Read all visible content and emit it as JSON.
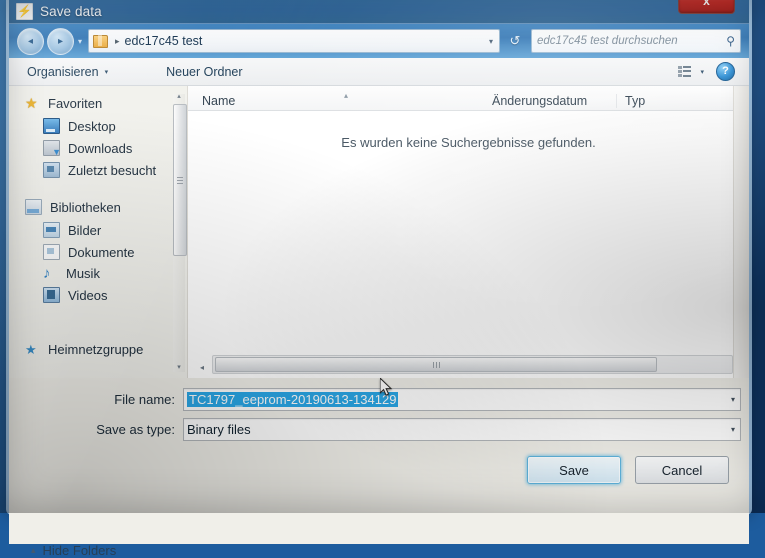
{
  "window": {
    "title": "Save data",
    "title_icon": "lightning-bolt-icon",
    "close_label": "x",
    "accent_titlebar": "#2a659e",
    "close_color": "#c0201b"
  },
  "nav": {
    "back_label": "◂",
    "forward_label": "▸",
    "history_chevron": "▾",
    "breadcrumb_folder_icon": "folder-icon",
    "breadcrumb_separator": "▸",
    "breadcrumb": "edc17c45 test",
    "address_dropdown": "▾",
    "refresh_label": "↺",
    "search": {
      "placeholder": "edc17c45 test durchsuchen",
      "value": "",
      "icon": "search-icon",
      "icon_glyph": "⚲"
    }
  },
  "toolbar": {
    "organize_label": "Organisieren",
    "organize_caret": "▾",
    "new_folder_label": "Neuer Ordner",
    "view_caret": "▾",
    "help_label": "?"
  },
  "sidebar": {
    "groups": [
      {
        "label": "Favoriten",
        "icon": "star-icon",
        "items": [
          {
            "label": "Desktop",
            "icon": "desktop-icon"
          },
          {
            "label": "Downloads",
            "icon": "downloads-icon"
          },
          {
            "label": "Zuletzt besucht",
            "icon": "recent-places-icon"
          }
        ]
      },
      {
        "label": "Bibliotheken",
        "icon": "libraries-icon",
        "items": [
          {
            "label": "Bilder",
            "icon": "pictures-icon"
          },
          {
            "label": "Dokumente",
            "icon": "documents-icon"
          },
          {
            "label": "Musik",
            "icon": "music-icon"
          },
          {
            "label": "Videos",
            "icon": "videos-icon"
          }
        ]
      },
      {
        "label": "Heimnetzgruppe",
        "icon": "homegroup-icon",
        "items": []
      }
    ],
    "scroll_up": "▴",
    "scroll_down": "▾"
  },
  "filelist": {
    "columns": [
      {
        "label": "Name"
      },
      {
        "label": "Änderungsdatum"
      },
      {
        "label": "Typ"
      }
    ],
    "sort_indicator": "▴",
    "rows": [],
    "empty_message": "Es wurden keine Suchergebnisse gefunden.",
    "hscroll_left": "◂",
    "hscroll_right": "▸",
    "hthumb_grip": "|||"
  },
  "form": {
    "file_name_label": "File name:",
    "file_name_value": "TC1797_eeprom-20190613-134129",
    "file_name_selected": true,
    "file_name_caret": "▾",
    "save_as_type_label": "Save as type:",
    "save_as_type_value": "Binary files",
    "save_as_type_caret": "▾",
    "save_button": "Save",
    "cancel_button": "Cancel",
    "hide_folders_label": "Hide Folders",
    "hide_folders_chevron": "▴",
    "selection_color": "#2aa8e8",
    "default_button_glow": "#6abee4"
  }
}
